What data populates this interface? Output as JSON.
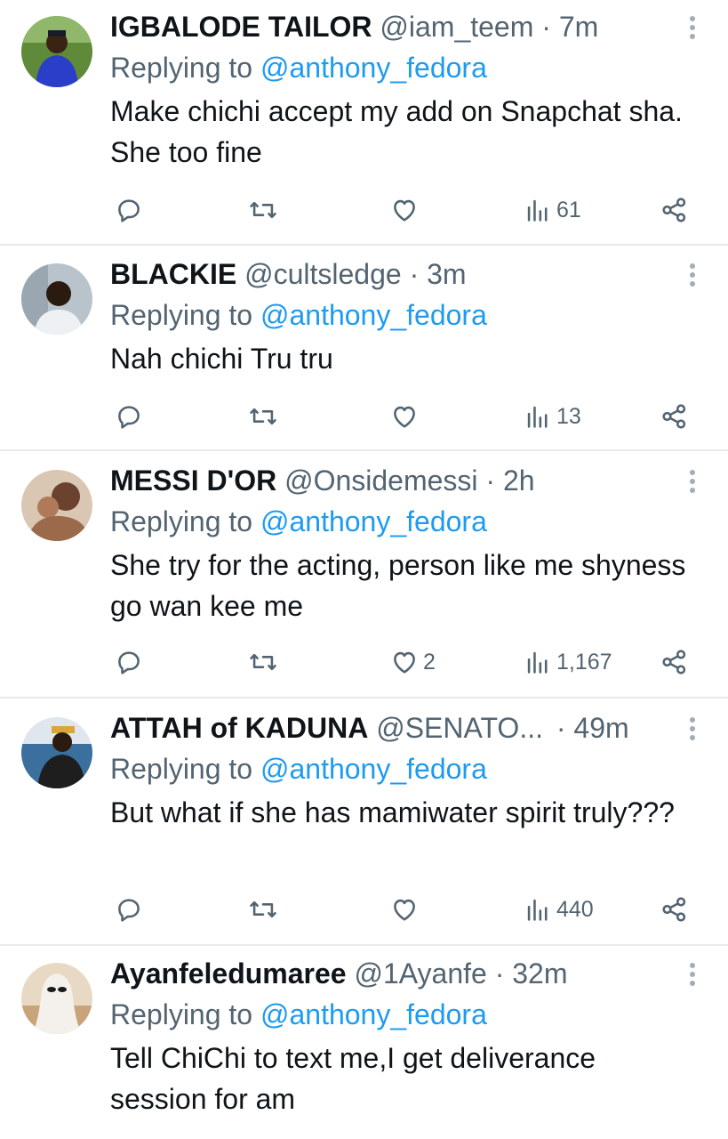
{
  "replying_prefix": "Replying to",
  "tweets": [
    {
      "name": "IGBALODE TAILOR",
      "handle": "@iam_teem",
      "dot": "·",
      "time": "7m",
      "reply_to": "@anthony_fedora",
      "text": "Make chichi accept my add on Snapchat sha. She too fine",
      "likes": "",
      "views": "61",
      "avatar_color": "#2b3ec9"
    },
    {
      "name": "BLACKIE",
      "handle": "@cultsledge",
      "dot": "·",
      "time": "3m",
      "reply_to": "@anthony_fedora",
      "text": "Nah chichi Tru tru",
      "likes": "",
      "views": "13",
      "avatar_color": "#8a9aa6"
    },
    {
      "name": "MESSI D'OR",
      "handle": "@Onsidemessi",
      "dot": "·",
      "time": "2h",
      "reply_to": "@anthony_fedora",
      "text": "She try for the acting, person like me shyness go wan kee me",
      "likes": "2",
      "views": "1,167",
      "avatar_color": "#9a6a4a"
    },
    {
      "name": "ATTAH of KADUNA",
      "handle": "@SENATO...",
      "dot": "·",
      "time": "49m",
      "reply_to": "@anthony_fedora",
      "text": "But what if she has mamiwater spirit truly???",
      "likes": "",
      "views": "440",
      "avatar_color": "#3a6f9e"
    },
    {
      "name": "Ayanfeledumaree",
      "handle": "@1Ayanfe",
      "dot": "·",
      "time": "32m",
      "reply_to": "@anthony_fedora",
      "text": "Tell ChiChi to text me,I get deliverance session for am",
      "likes": "",
      "views": "",
      "avatar_color": "#c9a47a"
    }
  ],
  "colors": {
    "text": "#0f1419",
    "muted": "#536471",
    "link": "#1d9bf0",
    "divider": "#e7e9ea"
  },
  "icons": [
    "reply-icon",
    "retweet-icon",
    "like-icon",
    "views-icon",
    "share-icon",
    "more-icon"
  ]
}
